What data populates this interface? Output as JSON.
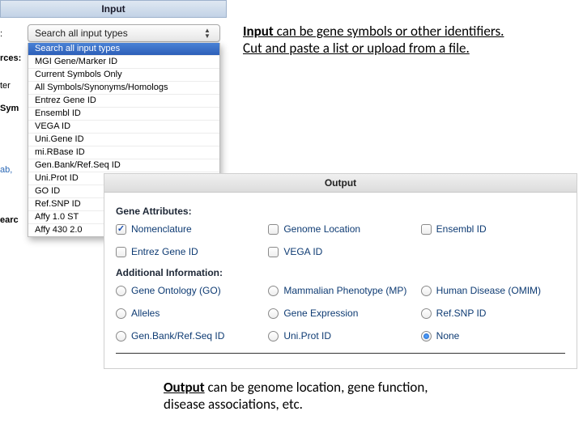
{
  "input": {
    "header": "Input",
    "dropdown_selected": "Search all input types",
    "dropdown_options": [
      "Search all input types",
      "MGI Gene/Marker ID",
      "Current Symbols Only",
      "All Symbols/Synonyms/Homologs",
      "Entrez Gene ID",
      "Ensembl ID",
      "VEGA ID",
      "Uni.Gene ID",
      "mi.RBase ID",
      "Gen.Bank/Ref.Seq ID",
      "Uni.Prot ID",
      "GO ID",
      "Ref.SNP ID",
      "Affy 1.0 ST",
      "Affy 430 2.0"
    ],
    "left_stubs": {
      "a": ":",
      "b": "rces:",
      "c": "ter",
      "d": "Sym",
      "e": "ab,",
      "f": "earc"
    }
  },
  "caption_input_lead": "Input",
  "caption_input_rest1": " can be gene symbols or other identifiers.",
  "caption_input_rest2": "Cut and paste a list or upload from a file.",
  "output": {
    "header": "Output",
    "gene_attr_label": "Gene Attributes:",
    "gene_attributes": [
      {
        "label": "Nomenclature",
        "checked": true
      },
      {
        "label": "Genome Location",
        "checked": false
      },
      {
        "label": "Ensembl ID",
        "checked": false
      },
      {
        "label": "Entrez Gene ID",
        "checked": false
      },
      {
        "label": "VEGA ID",
        "checked": false
      }
    ],
    "add_info_label": "Additional Information:",
    "additional_info": [
      {
        "label": "Gene Ontology (GO)",
        "checked": false
      },
      {
        "label": "Mammalian Phenotype (MP)",
        "checked": false
      },
      {
        "label": "Human Disease (OMIM)",
        "checked": false
      },
      {
        "label": "Alleles",
        "checked": false
      },
      {
        "label": "Gene Expression",
        "checked": false
      },
      {
        "label": "Ref.SNP ID",
        "checked": false
      },
      {
        "label": "Gen.Bank/Ref.Seq ID",
        "checked": false
      },
      {
        "label": "Uni.Prot ID",
        "checked": false
      },
      {
        "label": "None",
        "checked": true
      }
    ]
  },
  "caption_output_lead": "Output",
  "caption_output_rest1": " can be genome location, gene function,",
  "caption_output_rest2": "disease associations, etc."
}
